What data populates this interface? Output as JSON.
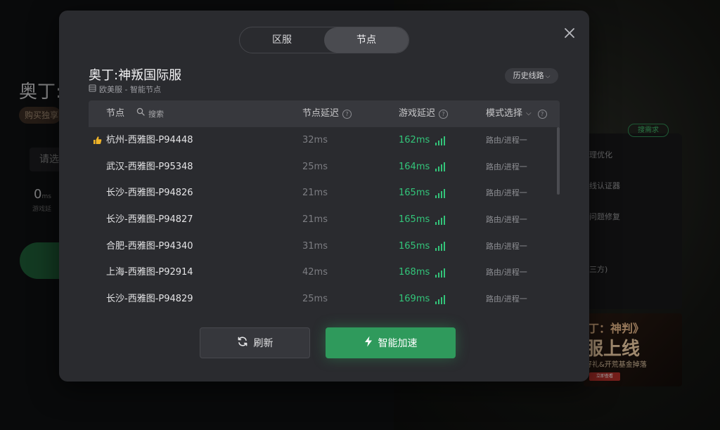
{
  "background": {
    "title": "奥丁:",
    "buy_badge": "购买独享",
    "select_text": "请选",
    "ms_value": "0",
    "ms_unit": "ms",
    "ms_label": "游戏延",
    "tag": "搜需求",
    "features": [
      "理优化",
      "线认证器",
      "问题修复"
    ],
    "extra_feature": "三方)",
    "banner": {
      "line1": "丁：神判》",
      "line2": "服上线",
      "line3": "好礼&开荒基金掉落",
      "button": "立即查看"
    }
  },
  "modal": {
    "tabs": [
      {
        "label": "区服",
        "active": false
      },
      {
        "label": "节点",
        "active": true
      }
    ],
    "server_title": "奥丁:神叛国际服",
    "server_sub": "欧美服 - 智能节点",
    "history_button": "历史线路",
    "table": {
      "col_node": "节点",
      "search_placeholder": "搜索",
      "col_node_delay": "节点延迟",
      "col_game_delay": "游戏延迟",
      "col_mode": "模式选择"
    },
    "rows": [
      {
        "name": "杭州-西雅图-P94448",
        "delay": "32ms",
        "game": "162ms",
        "mode": "路由/进程一",
        "recommended": true
      },
      {
        "name": "武汉-西雅图-P95348",
        "delay": "25ms",
        "game": "164ms",
        "mode": "路由/进程一",
        "recommended": false
      },
      {
        "name": "长沙-西雅图-P94826",
        "delay": "21ms",
        "game": "165ms",
        "mode": "路由/进程一",
        "recommended": false
      },
      {
        "name": "长沙-西雅图-P94827",
        "delay": "21ms",
        "game": "165ms",
        "mode": "路由/进程一",
        "recommended": false
      },
      {
        "name": "合肥-西雅图-P94340",
        "delay": "31ms",
        "game": "165ms",
        "mode": "路由/进程一",
        "recommended": false
      },
      {
        "name": "上海-西雅图-P92914",
        "delay": "42ms",
        "game": "168ms",
        "mode": "路由/进程一",
        "recommended": false
      },
      {
        "name": "长沙-西雅图-P94829",
        "delay": "25ms",
        "game": "169ms",
        "mode": "路由/进程一",
        "recommended": false
      }
    ],
    "refresh_button": "刷新",
    "accelerate_button": "智能加速"
  },
  "colors": {
    "accent_green": "#2f9a5c",
    "latency_green": "#33c57a",
    "modal_bg": "#2a2b2f"
  }
}
